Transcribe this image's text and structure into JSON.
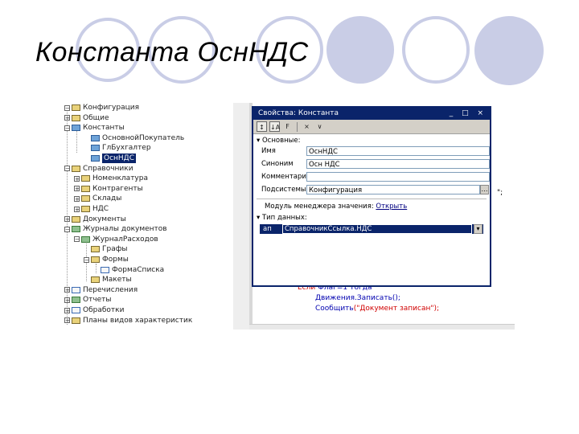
{
  "slide": {
    "title": "Константа ОснНДС"
  },
  "tree": {
    "items": [
      {
        "label": "Конфигурация",
        "expander": "−",
        "icon": "folder-icon",
        "selected": false
      },
      {
        "label": "Общие",
        "expander": "+",
        "icon": "folder-icon",
        "selected": false
      },
      {
        "label": "Константы",
        "expander": "−",
        "icon": "constants-icon",
        "selected": false
      },
      {
        "label": "ОсновнойПокупатель",
        "expander": "",
        "icon": "constant-icon",
        "selected": false
      },
      {
        "label": "ГлБухгалтер",
        "expander": "",
        "icon": "constant-icon",
        "selected": false
      },
      {
        "label": "ОснНДС",
        "expander": "",
        "icon": "constant-icon",
        "selected": true
      },
      {
        "label": "Справочники",
        "expander": "−",
        "icon": "folder-icon",
        "selected": false
      },
      {
        "label": "Номенклатура",
        "expander": "+",
        "icon": "catalog-icon",
        "selected": false
      },
      {
        "label": "Контрагенты",
        "expander": "+",
        "icon": "catalog-icon",
        "selected": false
      },
      {
        "label": "Склады",
        "expander": "+",
        "icon": "catalog-icon",
        "selected": false
      },
      {
        "label": "НДС",
        "expander": "+",
        "icon": "catalog-icon",
        "selected": false
      },
      {
        "label": "Документы",
        "expander": "+",
        "icon": "folder-icon",
        "selected": false
      },
      {
        "label": "Журналы документов",
        "expander": "−",
        "icon": "journal-icon",
        "selected": false
      },
      {
        "label": "ЖурналРасходов",
        "expander": "−",
        "icon": "journal-icon",
        "selected": false
      },
      {
        "label": "Графы",
        "expander": "",
        "icon": "folder-icon",
        "selected": false
      },
      {
        "label": "Формы",
        "expander": "−",
        "icon": "folder-icon",
        "selected": false
      },
      {
        "label": "ФормаСписка",
        "expander": "",
        "icon": "form-icon",
        "selected": false
      },
      {
        "label": "Макеты",
        "expander": "",
        "icon": "folder-icon",
        "selected": false
      },
      {
        "label": "Перечисления",
        "expander": "+",
        "icon": "enum-icon",
        "selected": false
      },
      {
        "label": "Отчеты",
        "expander": "+",
        "icon": "report-icon",
        "selected": false
      },
      {
        "label": "Обработки",
        "expander": "+",
        "icon": "processing-icon",
        "selected": false
      },
      {
        "label": "Планы видов характеристик",
        "expander": "+",
        "icon": "folder-icon",
        "selected": false
      }
    ]
  },
  "editor": {
    "line_right": "\";",
    "line1_kw": "Если",
    "line1_rest": " Флаг=1 Тогда",
    "line2": "Движения.Записать();",
    "line3_fn": "Сообщить",
    "line3_rest": "(\"Документ записан\");"
  },
  "dialog": {
    "title": "Свойства: Константа",
    "controls": "_ □ ×",
    "toolbar": [
      "↕",
      "↓A",
      "F",
      "×",
      "∨"
    ],
    "section_main": "Основные:",
    "props": [
      {
        "label": "Имя",
        "value": "ОснНДС"
      },
      {
        "label": "Синоним",
        "value": "Осн НДС"
      },
      {
        "label": "Комментарий",
        "value": ""
      },
      {
        "label": "Подсистемы",
        "value": "Конфигурация"
      }
    ],
    "module_label": "Модуль менеджера значения:",
    "module_link": "Открыть",
    "section_type": "Тип данных:",
    "type_prefix": "ап",
    "type_value": "СправочникСсылка.НДС"
  }
}
